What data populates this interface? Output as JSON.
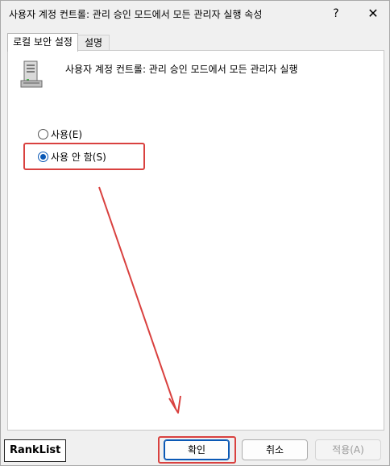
{
  "window": {
    "title": "사용자 계정 컨트롤: 관리 승인 모드에서 모든 관리자 실행 속성",
    "help_label": "?",
    "close_label": "✕"
  },
  "tabs": [
    {
      "label": "로컬 보안 설정",
      "active": true
    },
    {
      "label": "설명",
      "active": false
    }
  ],
  "policy": {
    "icon": "server-icon",
    "title": "사용자 계정 컨트롤: 관리 승인 모드에서 모든 관리자 실행"
  },
  "options": [
    {
      "label": "사용(E)",
      "checked": false
    },
    {
      "label": "사용 안 함(S)",
      "checked": true
    }
  ],
  "buttons": {
    "ok": "확인",
    "cancel": "취소",
    "apply": "적용(A)"
  },
  "watermark": "RankList",
  "annotation_color": "#d9413f"
}
